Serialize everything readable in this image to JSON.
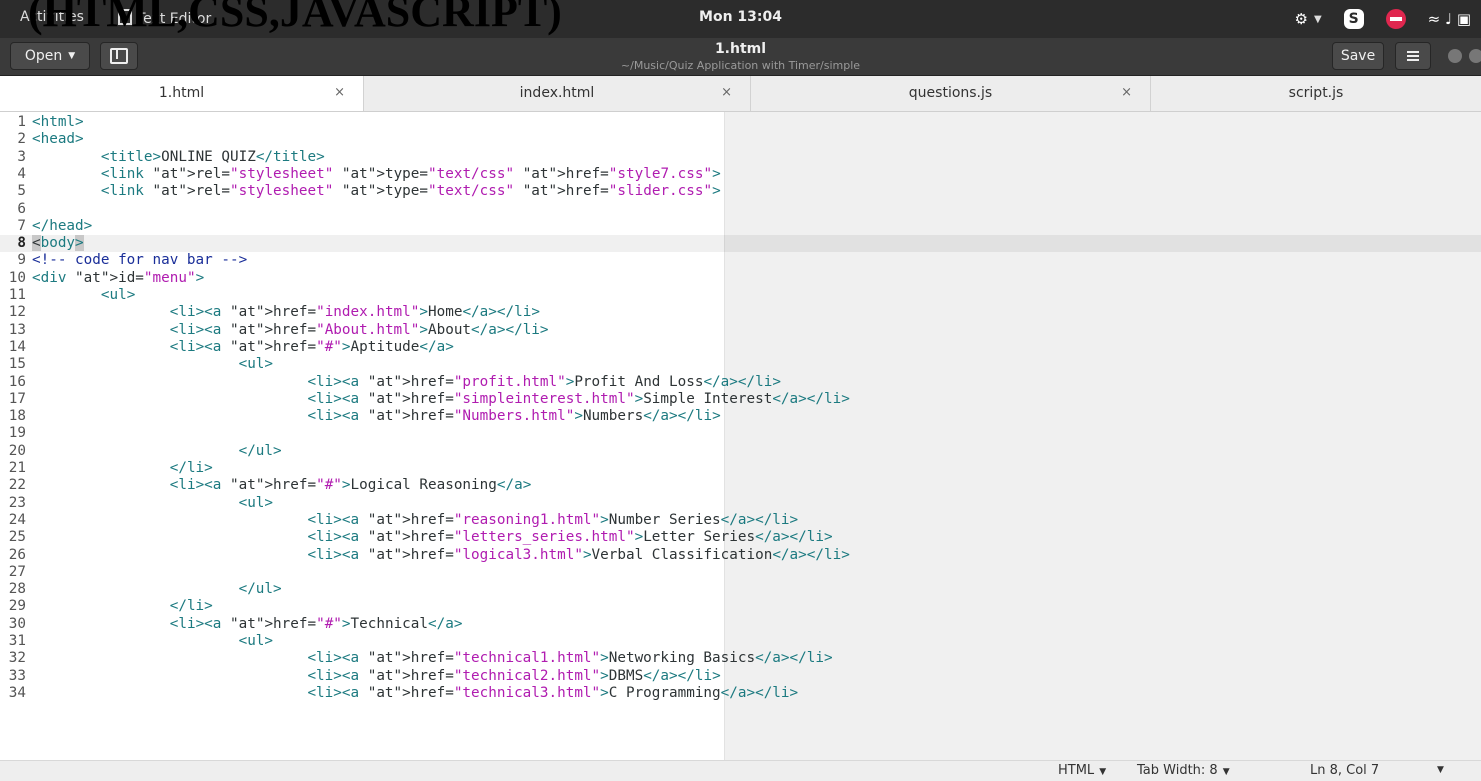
{
  "system_bar": {
    "activities": "Activities",
    "app_name": "Text Editor",
    "clock": "Mon 13:04"
  },
  "overlay_title": "(HTML,CSS,JAVASCRIPT)",
  "headerbar": {
    "open_label": "Open",
    "title": "1.html",
    "path": "~/Music/Quiz Application with Timer/simple",
    "save_label": "Save"
  },
  "tabs": [
    {
      "label": "1.html",
      "close": "×"
    },
    {
      "label": "index.html",
      "close": "×"
    },
    {
      "label": "questions.js",
      "close": "×"
    },
    {
      "label": "script.js",
      "close": ""
    }
  ],
  "editor": {
    "current_line": 8,
    "lines": [
      {
        "n": "1",
        "text": "<html>"
      },
      {
        "n": "2",
        "text": "<head>"
      },
      {
        "n": "3",
        "text": "\t<title>ONLINE QUIZ</title>"
      },
      {
        "n": "4",
        "text": "\t<link rel=\"stylesheet\" type=\"text/css\" href=\"style7.css\">"
      },
      {
        "n": "5",
        "text": "\t<link rel=\"stylesheet\" type=\"text/css\" href=\"slider.css\">"
      },
      {
        "n": "6",
        "text": ""
      },
      {
        "n": "7",
        "text": "</head>"
      },
      {
        "n": "8",
        "text": "<body>"
      },
      {
        "n": "9",
        "text": "<!-- code for nav bar -->"
      },
      {
        "n": "10",
        "text": "<div id=\"menu\">"
      },
      {
        "n": "11",
        "text": "\t<ul>"
      },
      {
        "n": "12",
        "text": "\t\t<li><a href=\"index.html\">Home</a></li>"
      },
      {
        "n": "13",
        "text": "\t\t<li><a href=\"About.html\">About</a></li>"
      },
      {
        "n": "14",
        "text": "\t\t<li><a href=\"#\">Aptitude</a>"
      },
      {
        "n": "15",
        "text": "\t\t\t<ul>"
      },
      {
        "n": "16",
        "text": "\t\t\t\t<li><a href=\"profit.html\">Profit And Loss</a></li>"
      },
      {
        "n": "17",
        "text": "\t\t\t\t<li><a href=\"simpleinterest.html\">Simple Interest</a></li>"
      },
      {
        "n": "18",
        "text": "\t\t\t\t<li><a href=\"Numbers.html\">Numbers</a></li>"
      },
      {
        "n": "19",
        "text": ""
      },
      {
        "n": "20",
        "text": "\t\t\t</ul>"
      },
      {
        "n": "21",
        "text": "\t\t</li>"
      },
      {
        "n": "22",
        "text": "\t\t<li><a href=\"#\">Logical Reasoning</a>"
      },
      {
        "n": "23",
        "text": "\t\t\t<ul>"
      },
      {
        "n": "24",
        "text": "\t\t\t\t<li><a href=\"reasoning1.html\">Number Series</a></li>"
      },
      {
        "n": "25",
        "text": "\t\t\t\t<li><a href=\"letters_series.html\">Letter Series</a></li>"
      },
      {
        "n": "26",
        "text": "\t\t\t\t<li><a href=\"logical3.html\">Verbal Classification</a></li>"
      },
      {
        "n": "27",
        "text": ""
      },
      {
        "n": "28",
        "text": "\t\t\t</ul>"
      },
      {
        "n": "29",
        "text": "\t\t</li>"
      },
      {
        "n": "30",
        "text": "\t\t<li><a href=\"#\">Technical</a>"
      },
      {
        "n": "31",
        "text": "\t\t\t<ul>"
      },
      {
        "n": "32",
        "text": "\t\t\t\t<li><a href=\"technical1.html\">Networking Basics</a></li>"
      },
      {
        "n": "33",
        "text": "\t\t\t\t<li><a href=\"technical2.html\">DBMS</a></li>"
      },
      {
        "n": "34",
        "text": "\t\t\t\t<li><a href=\"technical3.html\">C Programming</a></li>"
      }
    ]
  },
  "statusbar": {
    "language": "HTML",
    "tab_width": "Tab Width: 8",
    "position": "Ln 8, Col 7"
  }
}
